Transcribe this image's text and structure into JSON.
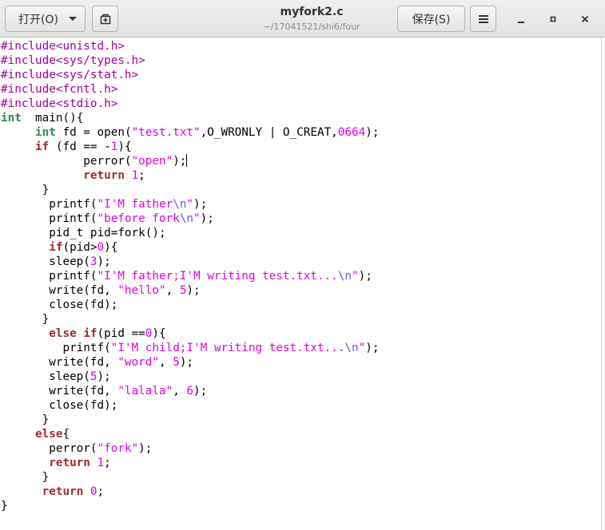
{
  "header": {
    "open_label": "打开(O)",
    "save_label": "保存(S)",
    "title": "myfork2.c",
    "subtitle": "~/17041521/shi6/four"
  },
  "icons": {
    "open_dropdown": "chevron-down-icon",
    "new_document": "new-document-icon",
    "menu": "hamburger-menu-icon",
    "minimize": "minimize-icon",
    "maximize": "maximize-icon",
    "close": "close-icon"
  },
  "colors": {
    "preprocessor": "#a000a0",
    "keyword": "#a52a2a",
    "type": "#2e8b57",
    "string": "#e000e0",
    "escape": "#6a5acd",
    "number": "#e000e0"
  },
  "editor": {
    "lines": [
      [
        [
          "pp",
          "#include<unistd.h>"
        ]
      ],
      [
        [
          "pp",
          "#include<sys/types.h>"
        ]
      ],
      [
        [
          "pp",
          "#include<sys/stat.h>"
        ]
      ],
      [
        [
          "pp",
          "#include<fcntl.h>"
        ]
      ],
      [
        [
          "pp",
          "#include<stdio.h>"
        ]
      ],
      [
        [
          "ty",
          "int"
        ],
        [
          "",
          "  main(){"
        ]
      ],
      [
        [
          "",
          "     "
        ],
        [
          "ty",
          "int"
        ],
        [
          "",
          " fd = open("
        ],
        [
          "st",
          "\"test.txt\""
        ],
        [
          "",
          ",O_WRONLY | O_CREAT,"
        ],
        [
          "nm",
          "0664"
        ],
        [
          "",
          ");"
        ]
      ],
      [
        [
          "",
          "     "
        ],
        [
          "kw",
          "if"
        ],
        [
          "",
          " (fd == -"
        ],
        [
          "nm",
          "1"
        ],
        [
          "",
          "){"
        ]
      ],
      [
        [
          "",
          "            perror("
        ],
        [
          "st",
          "\"open\""
        ],
        [
          "",
          ");"
        ],
        [
          "cursor",
          ""
        ]
      ],
      [
        [
          "",
          "            "
        ],
        [
          "kw",
          "return"
        ],
        [
          "",
          " "
        ],
        [
          "nm",
          "1"
        ],
        [
          "",
          ";"
        ]
      ],
      [
        [
          "",
          "      }"
        ]
      ],
      [
        [
          "",
          "       printf("
        ],
        [
          "st",
          "\"I'M father"
        ],
        [
          "es",
          "\\n"
        ],
        [
          "st",
          "\""
        ],
        [
          "",
          ");"
        ]
      ],
      [
        [
          "",
          "       printf("
        ],
        [
          "st",
          "\"before fork"
        ],
        [
          "es",
          "\\n"
        ],
        [
          "st",
          "\""
        ],
        [
          "",
          ");"
        ]
      ],
      [
        [
          "",
          "       pid_t pid=fork();"
        ]
      ],
      [
        [
          "",
          "       "
        ],
        [
          "kw",
          "if"
        ],
        [
          "",
          "(pid>"
        ],
        [
          "nm",
          "0"
        ],
        [
          "",
          "){"
        ]
      ],
      [
        [
          "",
          "       sleep("
        ],
        [
          "nm",
          "3"
        ],
        [
          "",
          ");"
        ]
      ],
      [
        [
          "",
          "       printf("
        ],
        [
          "st",
          "\"I'M father;I'M writing test.txt..."
        ],
        [
          "es",
          "\\n"
        ],
        [
          "st",
          "\""
        ],
        [
          "",
          ");"
        ]
      ],
      [
        [
          "",
          "       write(fd, "
        ],
        [
          "st",
          "\"hello\""
        ],
        [
          "",
          ", "
        ],
        [
          "nm",
          "5"
        ],
        [
          "",
          ");"
        ]
      ],
      [
        [
          "",
          "       close(fd);"
        ]
      ],
      [
        [
          "",
          "      }"
        ]
      ],
      [
        [
          "",
          "       "
        ],
        [
          "kw",
          "else"
        ],
        [
          "",
          " "
        ],
        [
          "kw",
          "if"
        ],
        [
          "",
          "(pid =="
        ],
        [
          "nm",
          "0"
        ],
        [
          "",
          "){"
        ]
      ],
      [
        [
          "",
          "         printf("
        ],
        [
          "st",
          "\"I'M child;I'M writing test.txt..."
        ],
        [
          "es",
          "\\n"
        ],
        [
          "st",
          "\""
        ],
        [
          "",
          ");"
        ]
      ],
      [
        [
          "",
          "       write(fd, "
        ],
        [
          "st",
          "\"word\""
        ],
        [
          "",
          ", "
        ],
        [
          "nm",
          "5"
        ],
        [
          "",
          ");"
        ]
      ],
      [
        [
          "",
          "       sleep("
        ],
        [
          "nm",
          "5"
        ],
        [
          "",
          ");"
        ]
      ],
      [
        [
          "",
          "       write(fd, "
        ],
        [
          "st",
          "\"lalala\""
        ],
        [
          "",
          ", "
        ],
        [
          "nm",
          "6"
        ],
        [
          "",
          ");"
        ]
      ],
      [
        [
          "",
          "       close(fd);"
        ]
      ],
      [
        [
          "",
          "      }"
        ]
      ],
      [
        [
          "",
          "     "
        ],
        [
          "kw",
          "else"
        ],
        [
          "",
          "{"
        ]
      ],
      [
        [
          "",
          "       perror("
        ],
        [
          "st",
          "\"fork\""
        ],
        [
          "",
          ");"
        ]
      ],
      [
        [
          "",
          "       "
        ],
        [
          "kw",
          "return"
        ],
        [
          "",
          " "
        ],
        [
          "nm",
          "1"
        ],
        [
          "",
          ";"
        ]
      ],
      [
        [
          "",
          "      }"
        ]
      ],
      [
        [
          "",
          "      "
        ],
        [
          "kw",
          "return"
        ],
        [
          "",
          " "
        ],
        [
          "nm",
          "0"
        ],
        [
          "",
          ";"
        ]
      ],
      [
        [
          "",
          "}"
        ]
      ]
    ]
  }
}
